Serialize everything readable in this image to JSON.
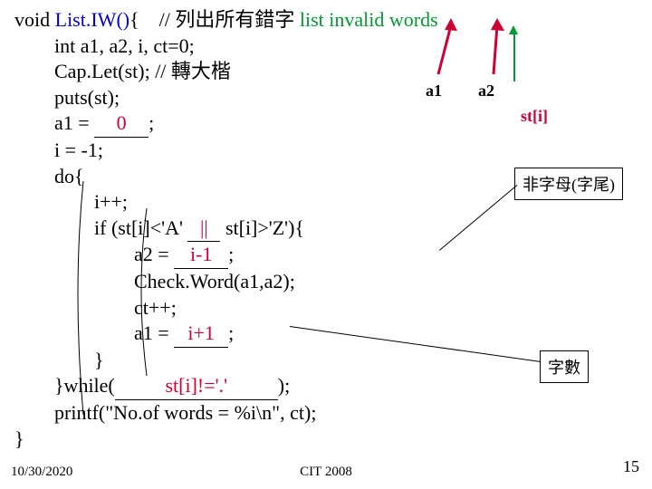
{
  "code": {
    "l1a": "void ",
    "l1b": "List.IW()",
    "l1c": "{    // 列出所有錯字 ",
    "l1d": "list invalid words",
    "l2": "        int a1, a2, i, ct=0;",
    "l3": "        Cap.Let(st); // 轉大楷",
    "l4": "        puts(st);",
    "l5a": "        a1 = ",
    "l5b": "0",
    "l5c": ";",
    "l6": "        i = -1;",
    "l7": "        do{",
    "l8": "                i++;",
    "l9a": "                if (st[i]<'A' ",
    "l9b": "||",
    "l9c": " st[i]>'Z'){",
    "l10a": "                        a2 = ",
    "l10b": "i-1",
    "l10c": ";",
    "l11": "                        Check.Word(a1,a2);",
    "l12": "                        ct++;",
    "l13a": "                        a1 = ",
    "l13b": "i+1",
    "l13c": ";",
    "l14": "                }",
    "l15a": "        }while(",
    "l15b": "st[i]!='.'",
    "l15c": ");",
    "l16": "        printf(\"No.of words = %i\\n\", ct);",
    "l17": "}"
  },
  "labels": {
    "a1": "a1",
    "a2": "a2",
    "sti": "st[i]",
    "box1": "非字母(字尾)",
    "box2": "字數"
  },
  "footer": {
    "date": "10/30/2020",
    "center": "CIT 2008",
    "page": "15"
  }
}
